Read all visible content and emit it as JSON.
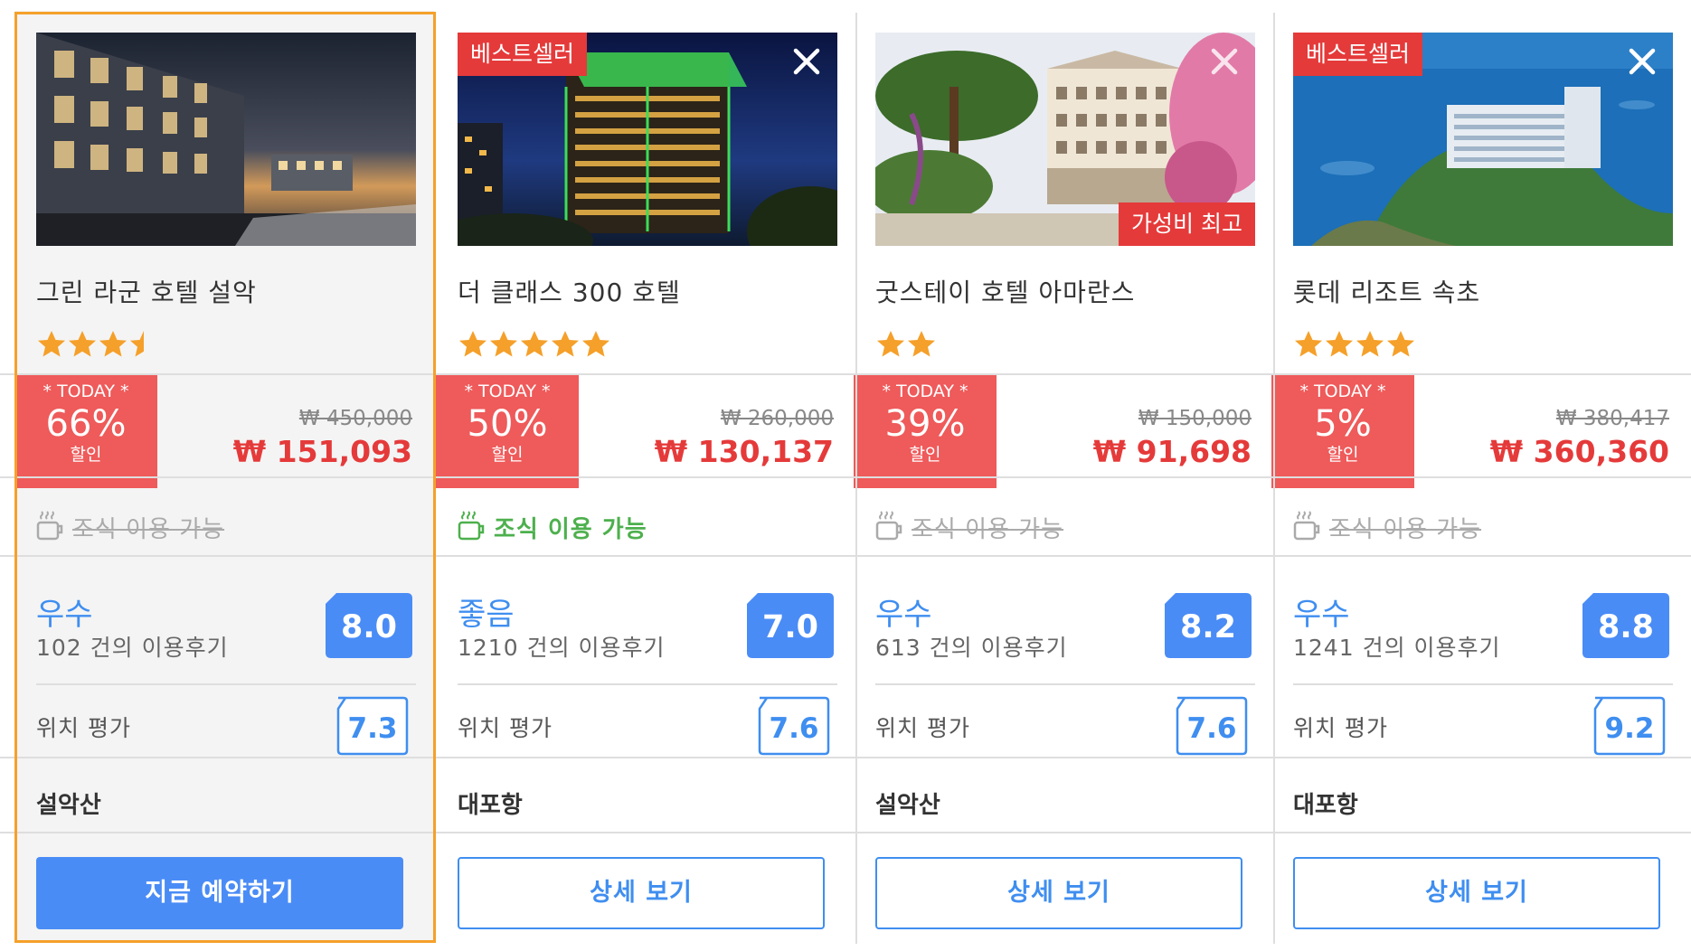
{
  "hotels": [
    {
      "name": "그린 라군 호텔 설악",
      "stars": 3.5,
      "badge": "",
      "value_badge": "",
      "closable": false,
      "today_label": "* TODAY *",
      "discount": "66%",
      "discount_label": "할인",
      "old_price": "₩ 450,000",
      "new_price": "₩ 151,093",
      "breakfast": "조식 이용 가능",
      "breakfast_available": false,
      "grade": "우수",
      "reviews": "102 건의 이용후기",
      "score": "8.0",
      "location_label": "위치 평가",
      "location_score": "7.3",
      "area": "설악산",
      "button": "지금 예약하기",
      "selected": true
    },
    {
      "name": "더 클래스 300 호텔",
      "stars": 5,
      "badge": "베스트셀러",
      "value_badge": "",
      "closable": true,
      "today_label": "* TODAY *",
      "discount": "50%",
      "discount_label": "할인",
      "old_price": "₩ 260,000",
      "new_price": "₩ 130,137",
      "breakfast": "조식 이용 가능",
      "breakfast_available": true,
      "grade": "좋음",
      "reviews": "1210 건의 이용후기",
      "score": "7.0",
      "location_label": "위치 평가",
      "location_score": "7.6",
      "area": "대포항",
      "button": "상세 보기",
      "selected": false
    },
    {
      "name": "굿스테이 호텔 아마란스",
      "stars": 2,
      "badge": "",
      "value_badge": "가성비 최고",
      "closable": true,
      "today_label": "* TODAY *",
      "discount": "39%",
      "discount_label": "할인",
      "old_price": "₩ 150,000",
      "new_price": "₩ 91,698",
      "breakfast": "조식 이용 가능",
      "breakfast_available": false,
      "grade": "우수",
      "reviews": "613 건의 이용후기",
      "score": "8.2",
      "location_label": "위치 평가",
      "location_score": "7.6",
      "area": "설악산",
      "button": "상세 보기",
      "selected": false
    },
    {
      "name": "롯데 리조트 속초",
      "stars": 4,
      "badge": "베스트셀러",
      "value_badge": "",
      "closable": true,
      "today_label": "* TODAY *",
      "discount": "5%",
      "discount_label": "할인",
      "old_price": "₩ 380,417",
      "new_price": "₩ 360,360",
      "breakfast": "조식 이용 가능",
      "breakfast_available": false,
      "grade": "우수",
      "reviews": "1241 건의 이용후기",
      "score": "8.8",
      "location_label": "위치 평가",
      "location_score": "9.2",
      "area": "대포항",
      "button": "상세 보기",
      "selected": false
    }
  ],
  "colors": {
    "accent_blue": "#3f8ef0",
    "sale_red": "#e53a3a",
    "today_red": "#ef5a5a",
    "star_orange": "#f5a02a",
    "breakfast_green": "#4db04d",
    "selected_outline": "#f5a02a"
  },
  "icons": {
    "close": "close-icon",
    "star": "star-icon",
    "half_star": "half-star-icon",
    "breakfast": "coffee-cup-icon"
  }
}
